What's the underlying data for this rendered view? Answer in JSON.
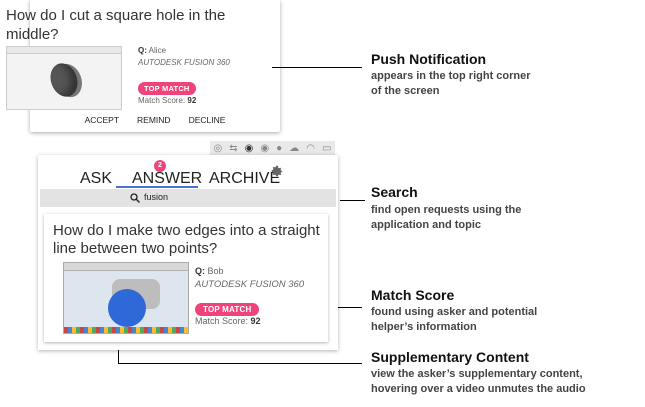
{
  "notification": {
    "title": "How do I cut a square hole in the middle?",
    "asker_prefix": "Q:",
    "asker": "Alice",
    "application": "AUTODESK FUSION 360",
    "badge": "TOP MATCH",
    "score_label": "Match Score:",
    "score": "92",
    "actions": {
      "accept": "ACCEPT",
      "remind": "REMIND",
      "decline": "DECLINE"
    }
  },
  "panel": {
    "tabs": {
      "ask": "ASK",
      "answer": "ANSWER",
      "archive": "ARCHIVE"
    },
    "answer_badge": "2",
    "search_value": "fusion",
    "card": {
      "title": "How do I make two edges into a straight line between two points?",
      "asker_prefix": "Q:",
      "asker": "Bob",
      "application": "AUTODESK FUSION 360",
      "badge": "TOP MATCH",
      "score_label": "Match Score:",
      "score": "92"
    }
  },
  "callouts": {
    "push": {
      "title": "Push Notification",
      "desc1": "appears in the top right corner",
      "desc2": "of the screen"
    },
    "search": {
      "title": "Search",
      "desc1": "find open requests using the",
      "desc2": "application and topic"
    },
    "match": {
      "title": "Match Score",
      "desc1": "found using asker and potential",
      "desc2": "helper’s information"
    },
    "supp": {
      "title": "Supplementary Content",
      "desc1": "view the asker’s supplementary content,",
      "desc2": "hovering over a video unmutes the audio"
    }
  },
  "colors": {
    "pill": "#f0437a",
    "active_tab": "#4a6fd6"
  }
}
